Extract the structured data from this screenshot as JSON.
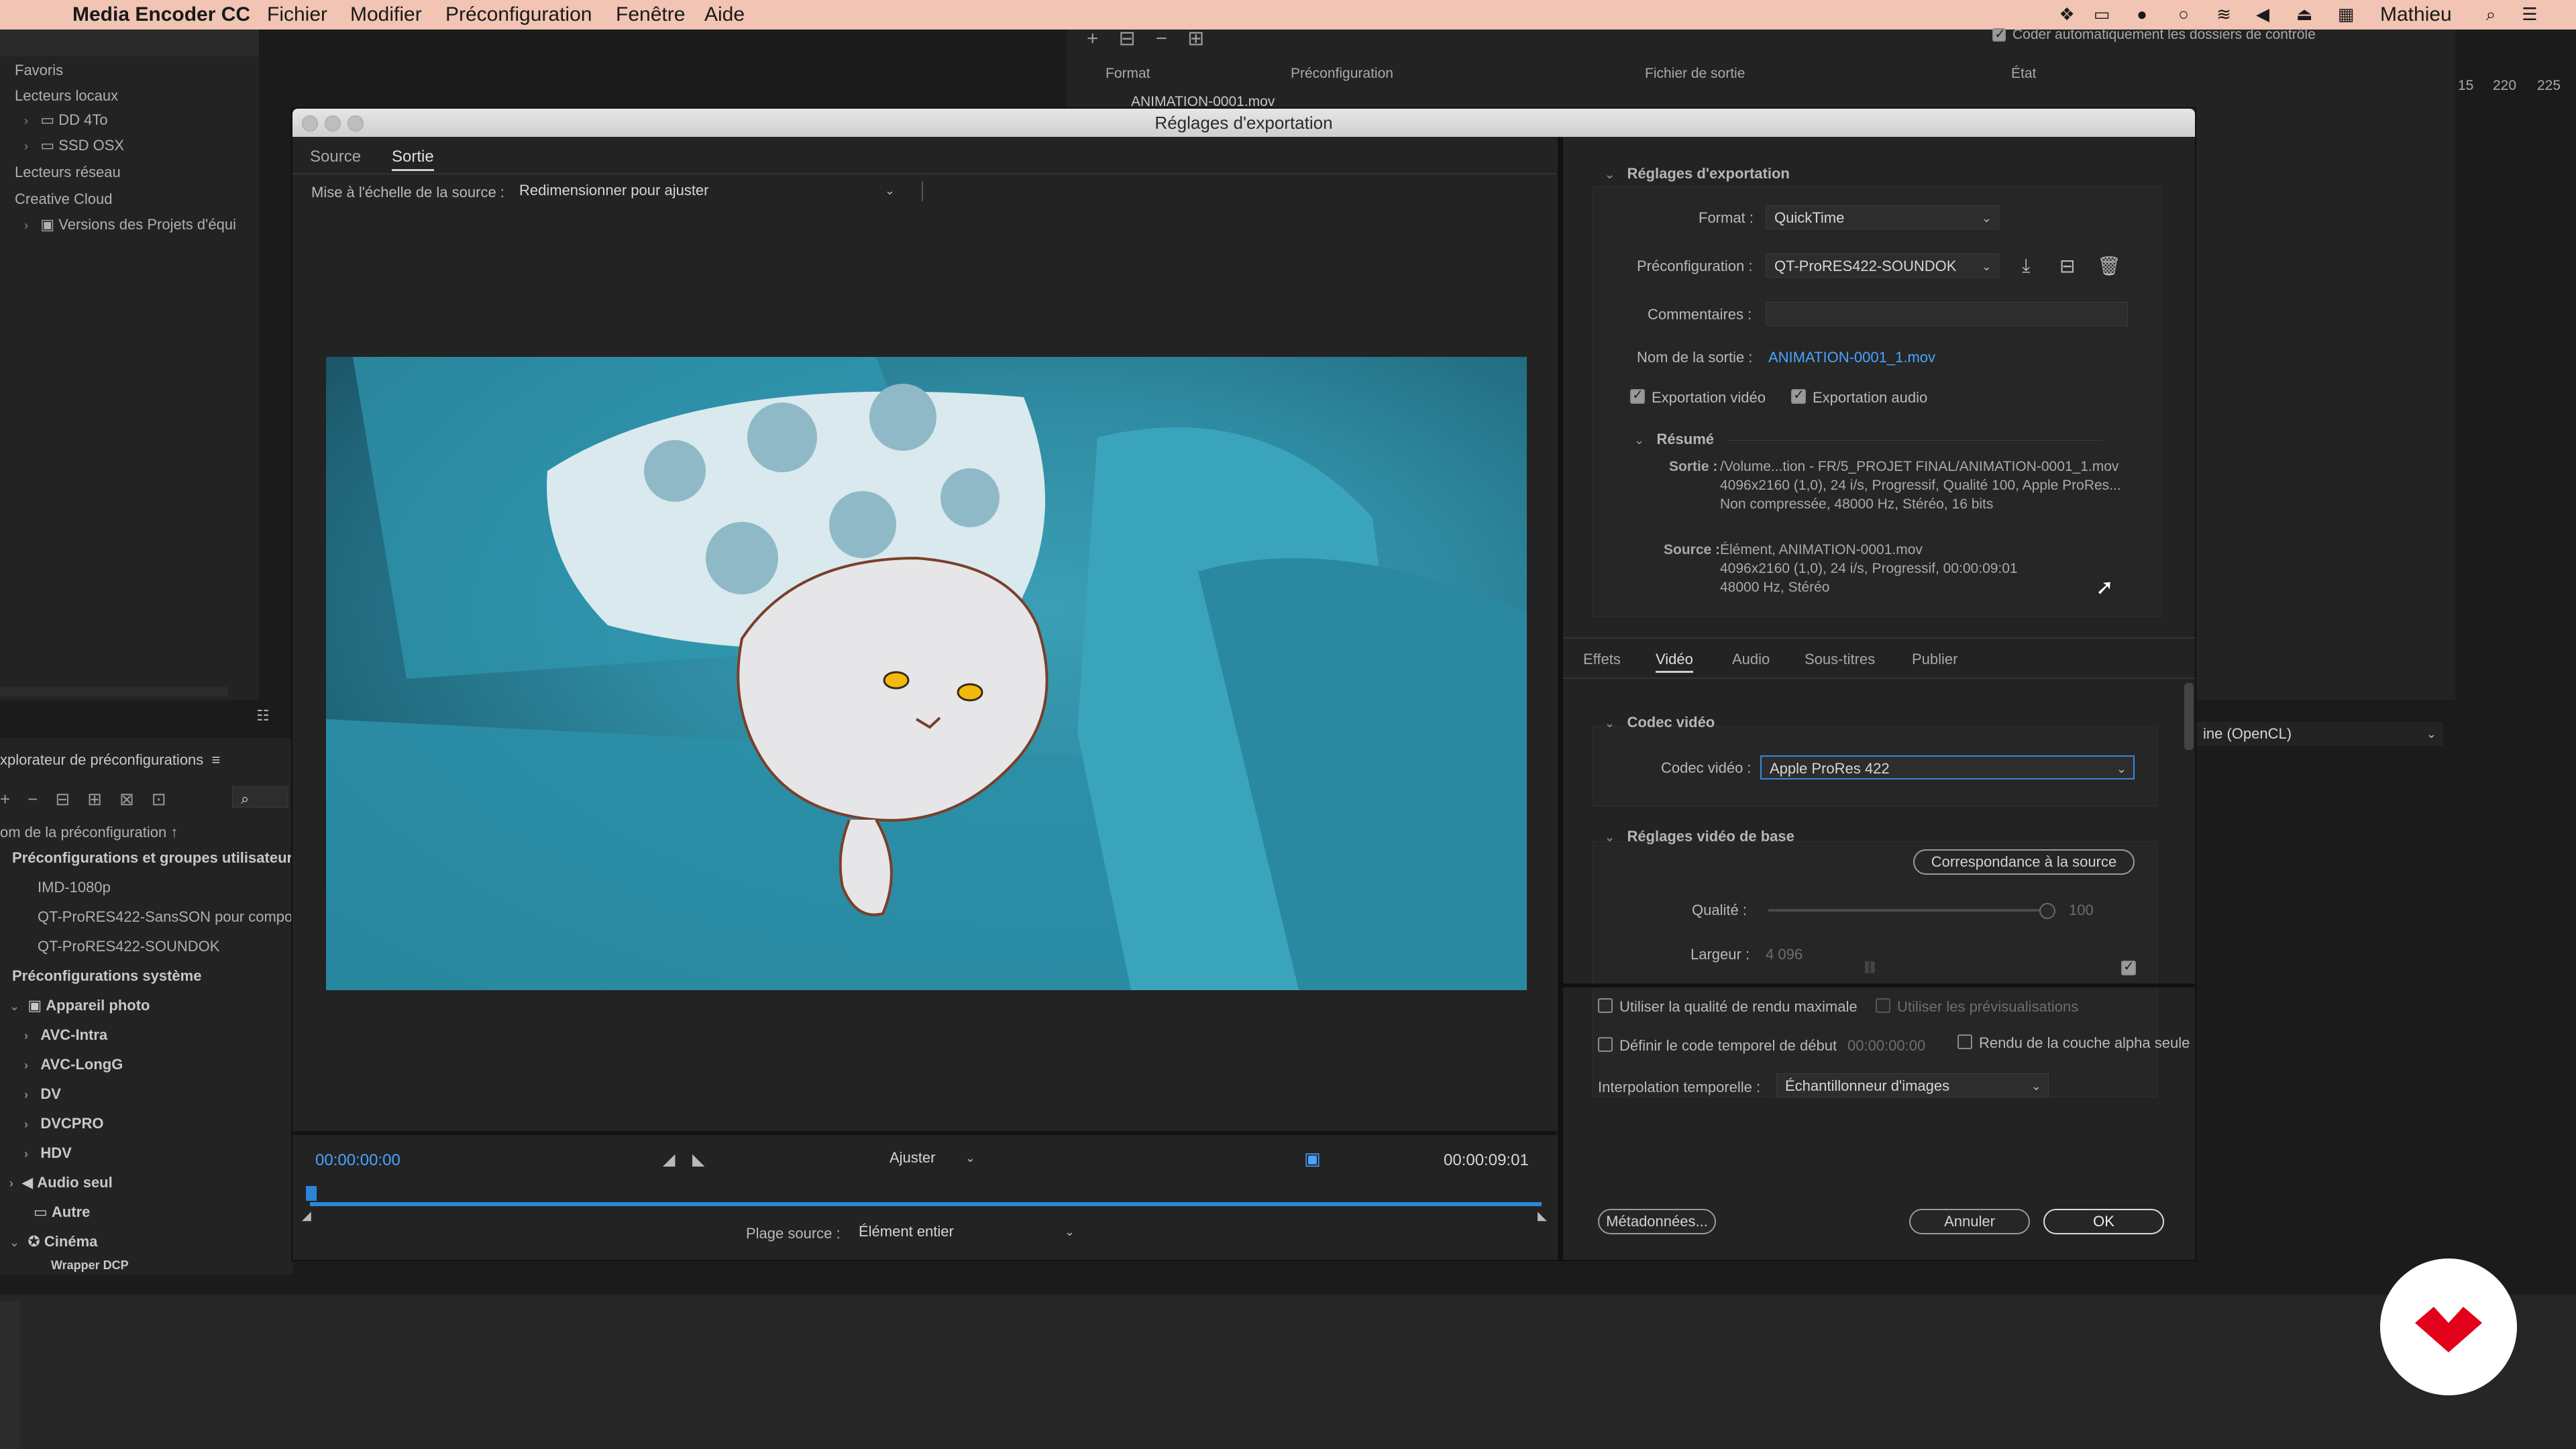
{
  "menubar": {
    "app_name": "Media Encoder CC",
    "menus": [
      "Fichier",
      "Modifier",
      "Préconfiguration",
      "Fenêtre",
      "Aide"
    ],
    "user": "Mathieu"
  },
  "background_app": {
    "media_browser": {
      "items": [
        "Favoris",
        "Lecteurs locaux",
        "DD 4To",
        "SSD OSX",
        "Lecteurs réseau",
        "Creative Cloud",
        "Versions des Projets d'équi"
      ]
    },
    "queue": {
      "auto_encode_label": "Coder automatiquement les dossiers de contrôle",
      "columns": [
        "Format",
        "Préconfiguration",
        "Fichier de sortie",
        "État"
      ],
      "item_name": "ANIMATION-0001.mov"
    },
    "preset_browser": {
      "title": "xplorateur de préconfigurations",
      "column_header": "om de la préconfiguration ↑",
      "user_group_title": "Préconfigurations et groupes utilisateur",
      "user_presets": [
        "IMD-1080p",
        "QT-ProRES422-SansSON pour compo",
        "QT-ProRES422-SOUNDOK"
      ],
      "system_group_title": "Préconfigurations système",
      "system_presets": [
        "Appareil photo",
        "AVC-Intra",
        "AVC-LongG",
        "DV",
        "DVCPRO",
        "HDV",
        "Audio seul",
        "Autre",
        "Cinéma",
        "Wrapper DCP"
      ]
    },
    "right_panel": {
      "renderer": "ine (OpenCL)",
      "ruler_ticks": [
        "15",
        "220",
        "225"
      ]
    }
  },
  "dialog": {
    "title": "Réglages d'exportation",
    "left_tabs": [
      "Source",
      "Sortie"
    ],
    "source_scaling_label": "Mise à l'échelle de la source :",
    "source_scaling_value": "Redimensionner pour ajuster",
    "timecode_start": "00:00:00:00",
    "timecode_end": "00:00:09:01",
    "fit_value": "Ajuster",
    "source_range_label": "Plage source :",
    "source_range_value": "Élément entier",
    "export_settings": {
      "section_title": "Réglages d'exportation",
      "format_label": "Format :",
      "format_value": "QuickTime",
      "preset_label": "Préconfiguration :",
      "preset_value": "QT-ProRES422-SOUNDOK",
      "comments_label": "Commentaires :",
      "comments_value": "",
      "output_name_label": "Nom de la sortie :",
      "output_name_value": "ANIMATION-0001_1.mov",
      "export_video_label": "Exportation vidéo",
      "export_audio_label": "Exportation audio",
      "summary_title": "Résumé",
      "output_label": "Sortie :",
      "output_lines": [
        "/Volume...tion - FR/5_PROJET FINAL/ANIMATION-0001_1.mov",
        "4096x2160 (1,0), 24 i/s, Progressif, Qualité  100, Apple ProRes...",
        "Non compressée, 48000  Hz, Stéréo, 16 bits"
      ],
      "source_label": "Source :",
      "source_lines": [
        "Élément, ANIMATION-0001.mov",
        "4096x2160 (1,0), 24 i/s, Progressif, 00:00:09:01",
        "48000 Hz, Stéréo"
      ]
    },
    "right_tabs": [
      "Effets",
      "Vidéo",
      "Audio",
      "Sous-titres",
      "Publier"
    ],
    "video": {
      "codec_section": "Codec vidéo",
      "codec_label": "Codec vidéo :",
      "codec_value": "Apple ProRes 422",
      "basic_section": "Réglages vidéo de base",
      "match_source_button": "Correspondance à la source",
      "quality_label": "Qualité :",
      "quality_value": "100",
      "width_label": "Largeur :",
      "width_value": "4 096"
    },
    "options": {
      "max_render_quality": "Utiliser la qualité de rendu maximale",
      "use_previews": "Utiliser les prévisualisations",
      "set_start_timecode": "Définir le code temporel de début",
      "start_timecode_value": "00:00:00:00",
      "alpha_only": "Rendu de la couche alpha seule",
      "time_interpolation_label": "Interpolation temporelle :",
      "time_interpolation_value": "Échantillonneur d'images"
    },
    "buttons": {
      "metadata": "Métadonnées...",
      "cancel": "Annuler",
      "ok": "OK"
    }
  }
}
